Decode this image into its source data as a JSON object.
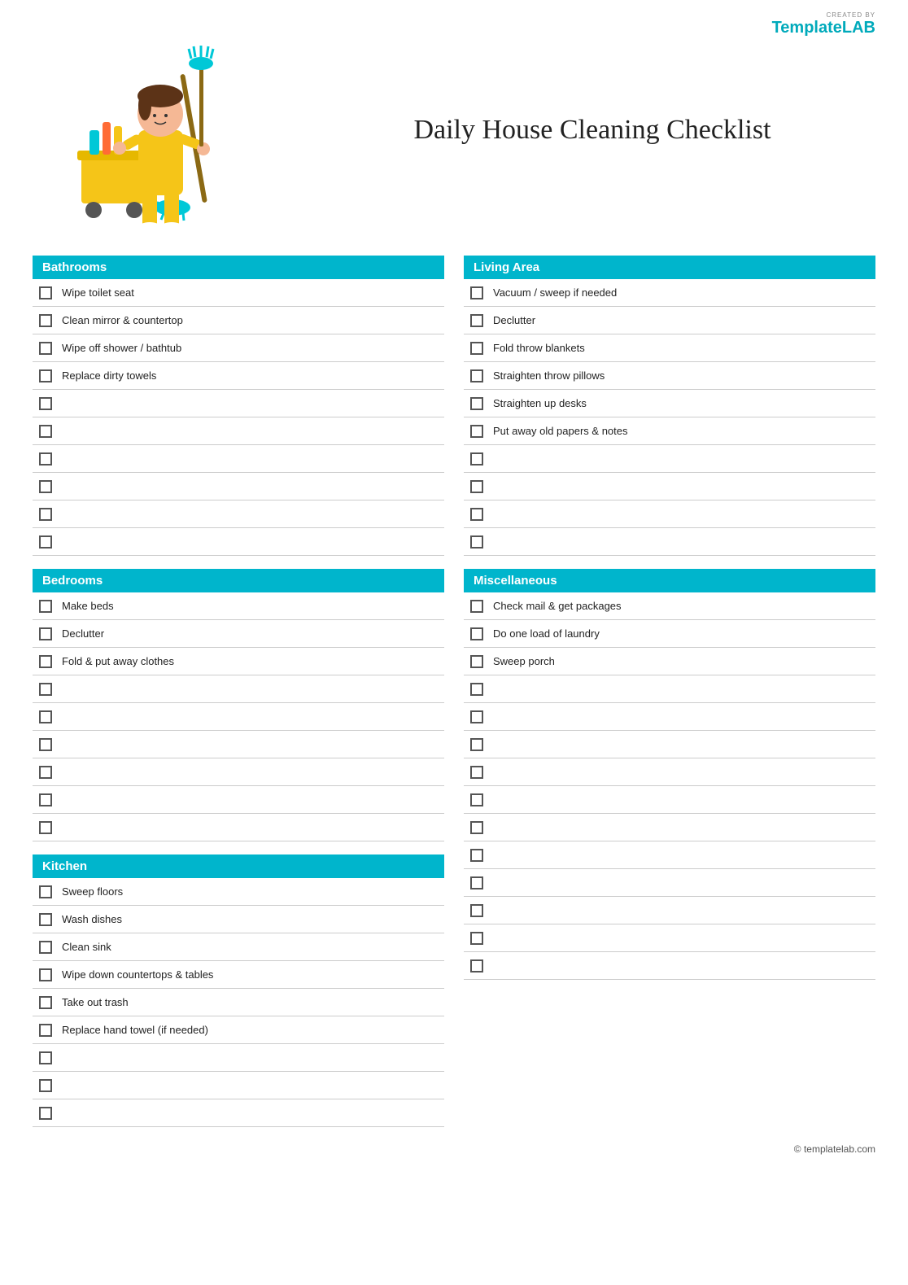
{
  "logo": {
    "created_by": "CREATED BY",
    "template": "Template",
    "lab": "LAB"
  },
  "title": "Daily House Cleaning Checklist",
  "sections": {
    "bathrooms": {
      "label": "Bathrooms",
      "items": [
        "Wipe toilet seat",
        "Clean mirror & countertop",
        "Wipe off shower / bathtub",
        "Replace dirty towels",
        "",
        "",
        "",
        "",
        "",
        ""
      ]
    },
    "bedrooms": {
      "label": "Bedrooms",
      "items": [
        "Make beds",
        "Declutter",
        "Fold & put away clothes",
        "",
        "",
        "",
        "",
        "",
        ""
      ]
    },
    "kitchen": {
      "label": "Kitchen",
      "items": [
        "Sweep floors",
        "Wash dishes",
        "Clean sink",
        "Wipe down countertops & tables",
        "Take out trash",
        "Replace hand towel (if needed)",
        "",
        "",
        ""
      ]
    },
    "living_area": {
      "label": "Living Area",
      "items": [
        "Vacuum / sweep if needed",
        "Declutter",
        "Fold throw blankets",
        "Straighten throw pillows",
        "Straighten up desks",
        "Put away old papers & notes",
        "",
        "",
        "",
        ""
      ]
    },
    "miscellaneous": {
      "label": "Miscellaneous",
      "items": [
        "Check mail & get packages",
        "Do one load of laundry",
        "Sweep porch",
        "",
        "",
        "",
        "",
        "",
        "",
        "",
        "",
        "",
        "",
        ""
      ]
    }
  },
  "footer": {
    "text": "© templatelab.com"
  }
}
